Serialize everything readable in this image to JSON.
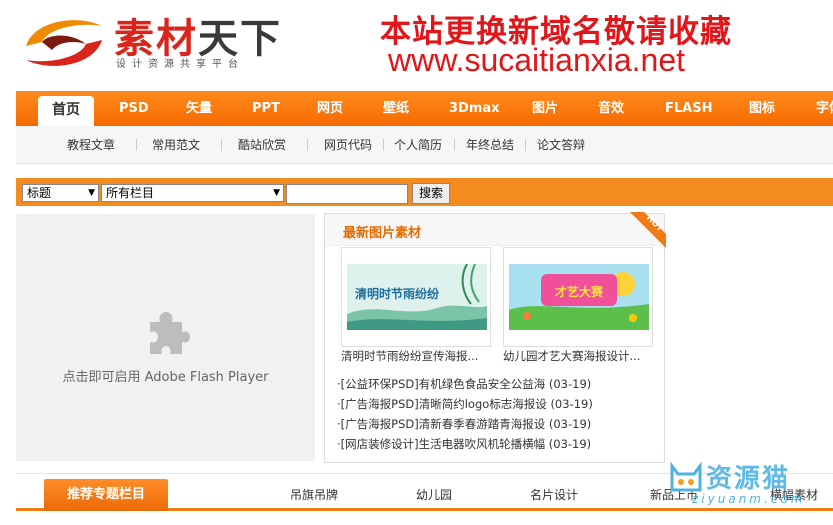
{
  "header": {
    "logo_title_a": "素材",
    "logo_title_b": "天下",
    "logo_sub": "设计资源共享平台",
    "ad_line1": "本站更换新域名敬请收藏",
    "ad_line2": "www.sucaitianxia.net"
  },
  "mainnav": {
    "items": [
      "首页",
      "PSD",
      "矢量",
      "PPT",
      "网页",
      "壁纸",
      "3Dmax",
      "图片",
      "音效",
      "FLASH",
      "图标",
      "字体"
    ]
  },
  "subnav": {
    "items": [
      "教程文章",
      "常用范文",
      "酷站欣赏",
      "网页代码",
      "个人简历",
      "年终总结",
      "论文答辩"
    ]
  },
  "search": {
    "select1": "标题",
    "select2": "所有栏目",
    "keyword": "",
    "button": "搜索"
  },
  "flash": {
    "text": "点击即可启用 Adobe Flash Player"
  },
  "newbox": {
    "title": "最新图片素材",
    "hot": "HOT",
    "thumbs": [
      {
        "caption": "清明时节雨纷纷宣传海报...",
        "art_text": "清明时节雨纷纷"
      },
      {
        "caption": "幼儿园才艺大赛海报设计...",
        "art_text": "才艺大赛"
      }
    ],
    "list": [
      "·[公益环保PSD]有机绿色食品安全公益海 (03-19)",
      "·[广告海报PSD]清晰简约logo标志海报设 (03-19)",
      "·[广告海报PSD]清新春季春游踏青海报设 (03-19)",
      "·[网店装修设计]生活电器吹风机轮播横幅 (03-19)"
    ]
  },
  "recbar": {
    "tab": "推荐专题栏目",
    "items": [
      "吊旗吊牌",
      "幼儿园",
      "名片设计",
      "新品上市",
      "横幅素材"
    ]
  },
  "watermark": {
    "text": "资源猫",
    "sub": "ziyuanm.com"
  }
}
